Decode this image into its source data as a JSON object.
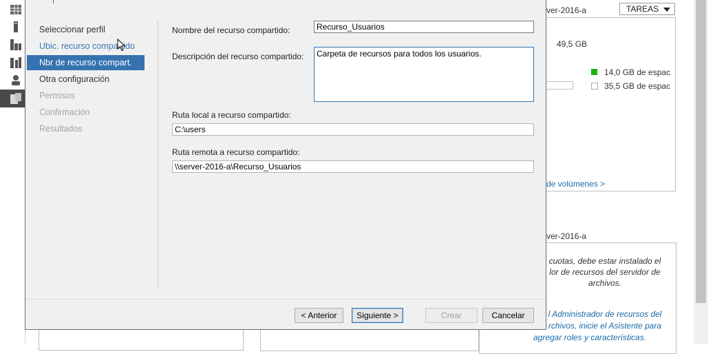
{
  "background": {
    "server_name_top": "ver-2016-a",
    "tasks_button": "TAREAS",
    "capacity": "49,5 GB",
    "used_space": "14,0 GB de espac",
    "free_space": "35,5 GB de espac",
    "used_color": "#16b216",
    "volumes_link": "de volúmenes >",
    "server_name_bottom": "ver-2016-a",
    "quota_note": [
      "cuotas, debe estar instalado el",
      "lor de recursos del servidor de",
      "archivos."
    ],
    "install_link": [
      "l Administrador de recursos del",
      "rchivos, inicie el Asistente para",
      "agregar roles y características."
    ],
    "sidebar_icons": [
      "dashboard-icon",
      "local-server-icon",
      "all-servers-icon",
      "roles-icon",
      "users-icon",
      "file-services-icon"
    ]
  },
  "wizard": {
    "nav": [
      {
        "label": "Seleccionar perfil",
        "state": "normal"
      },
      {
        "label": "Ubic. recurso compartido",
        "state": "link"
      },
      {
        "label": "Nbr de recurso compart.",
        "state": "selected"
      },
      {
        "label": "Otra configuración",
        "state": "normal"
      },
      {
        "label": "Permisos",
        "state": "disabled"
      },
      {
        "label": "Confirmación",
        "state": "disabled"
      },
      {
        "label": "Resultados",
        "state": "disabled"
      }
    ],
    "share_name_label": "Nombre del recurso compartido:",
    "share_name_value": "Recurso_Usuarios",
    "description_label": "Descripción del recurso compartido:",
    "description_value": "Carpeta de recursos para todos los usuarios.",
    "local_path_label": "Ruta local a recurso compartido:",
    "local_path_value": "C:\\users",
    "remote_path_label": "Ruta remota a recurso compartido:",
    "remote_path_value": "\\\\server-2016-a\\Recurso_Usuarios",
    "buttons": {
      "previous": "< Anterior",
      "next": "Siguiente >",
      "create": "Crear",
      "cancel": "Cancelar"
    },
    "accent_color": "#3572b0"
  }
}
